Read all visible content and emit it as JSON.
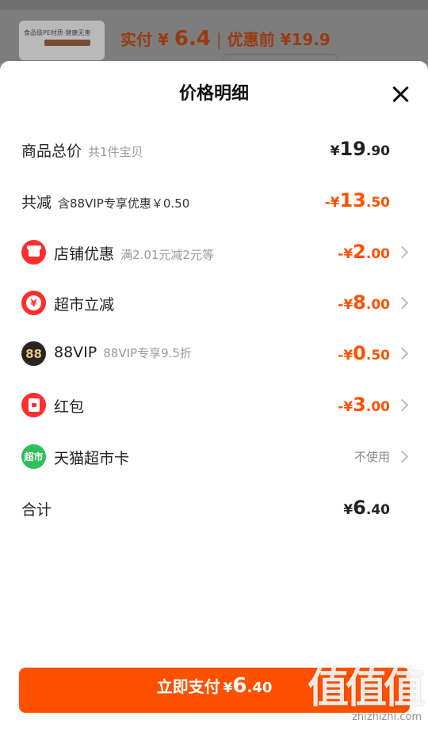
{
  "background": {
    "thumb_text": "食品级PE材质·健康无害",
    "price_prefix": "实付",
    "price_currency": "¥",
    "price_value": "6.4",
    "price_separator": "|",
    "price_before": "优惠前 ¥19.9"
  },
  "sheet": {
    "title": "价格明细"
  },
  "rows": {
    "total": {
      "label": "商品总价",
      "sub": "共1件宝贝",
      "cur": "¥",
      "int": "19",
      "dec": ".90"
    },
    "reduce": {
      "label": "共减",
      "sub": "含88VIP专享优惠￥0.50",
      "cur": "-¥",
      "int": "13",
      "dec": ".50"
    },
    "shop": {
      "label": "店铺优惠",
      "sub": "满2.01元减2元等",
      "cur": "-¥",
      "int": "2",
      "dec": ".00",
      "icon": "shop-icon"
    },
    "market": {
      "label": "超市立减",
      "sub": "",
      "cur": "-¥",
      "int": "8",
      "dec": ".00",
      "icon": "yen-coin-icon",
      "icon_glyph": "¥"
    },
    "vip": {
      "label": "88VIP",
      "sub": "88VIP专享9.5折",
      "cur": "-¥",
      "int": "0",
      "dec": ".50",
      "icon": "88vip-icon",
      "icon_glyph": "88"
    },
    "redpacket": {
      "label": "红包",
      "sub": "",
      "cur": "-¥",
      "int": "3",
      "dec": ".00",
      "icon": "red-packet-icon"
    },
    "card": {
      "label": "天猫超市卡",
      "status": "不使用",
      "icon": "tmall-market-icon",
      "icon_glyph": "超市"
    },
    "sum": {
      "label": "合计",
      "cur": "¥",
      "int": "6",
      "dec": ".40"
    }
  },
  "pay": {
    "label": "立即支付",
    "cur": "¥",
    "int": "6",
    "dec": ".40"
  },
  "watermark": {
    "text": "值值值",
    "url": "zhizhizhi.com"
  },
  "colors": {
    "accent": "#ff5000",
    "discount": "#ff5000",
    "icon_red": "#ff2e2e",
    "icon_green": "#2fbf5a",
    "vip_dark": "#2a2520"
  }
}
